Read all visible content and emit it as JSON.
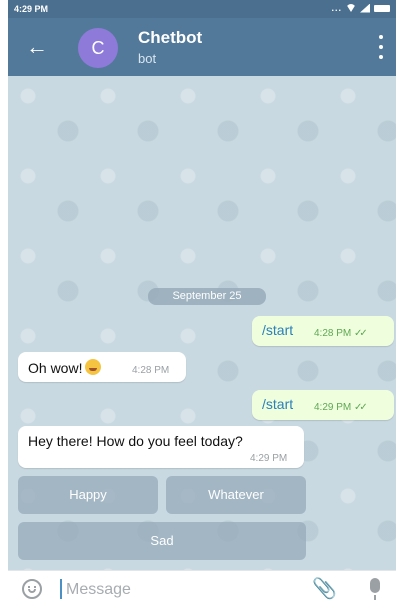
{
  "status_bar": {
    "time": "4:29 PM",
    "dots": "..."
  },
  "header": {
    "back_icon": "back-arrow-icon",
    "avatar_letter": "C",
    "title": "Chetbot",
    "subtitle": "bot",
    "menu_icon": "more-vert-icon",
    "color": "#52799a"
  },
  "chat": {
    "date": "September 25",
    "messages": [
      {
        "side": "out",
        "text": "/start",
        "time": "4:28 PM"
      },
      {
        "side": "in",
        "text": "Oh wow!",
        "emoji": "grinning-face",
        "time": "4:28 PM"
      },
      {
        "side": "out",
        "text": "/start",
        "time": "4:29 PM"
      },
      {
        "side": "in",
        "text": "Hey there! How do you feel today?",
        "time": "4:29 PM"
      }
    ],
    "keyboard": [
      "Happy",
      "Whatever",
      "Sad"
    ]
  },
  "input_bar": {
    "placeholder": "Message"
  }
}
